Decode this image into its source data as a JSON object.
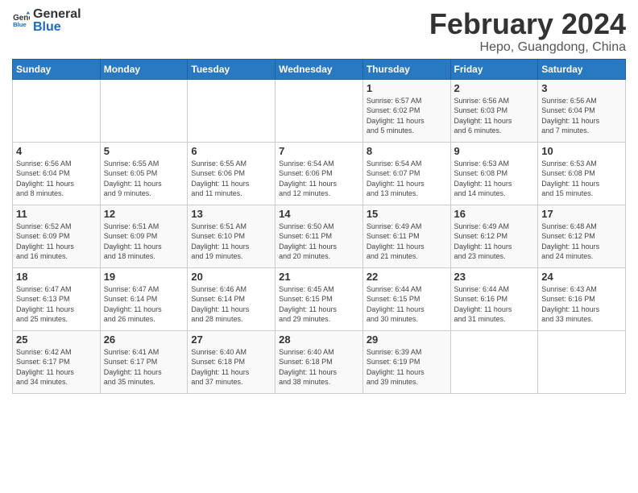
{
  "header": {
    "logo_general": "General",
    "logo_blue": "Blue",
    "title": "February 2024",
    "subtitle": "Hepo, Guangdong, China"
  },
  "weekdays": [
    "Sunday",
    "Monday",
    "Tuesday",
    "Wednesday",
    "Thursday",
    "Friday",
    "Saturday"
  ],
  "weeks": [
    [
      {
        "day": "",
        "info": ""
      },
      {
        "day": "",
        "info": ""
      },
      {
        "day": "",
        "info": ""
      },
      {
        "day": "",
        "info": ""
      },
      {
        "day": "1",
        "info": "Sunrise: 6:57 AM\nSunset: 6:02 PM\nDaylight: 11 hours\nand 5 minutes."
      },
      {
        "day": "2",
        "info": "Sunrise: 6:56 AM\nSunset: 6:03 PM\nDaylight: 11 hours\nand 6 minutes."
      },
      {
        "day": "3",
        "info": "Sunrise: 6:56 AM\nSunset: 6:04 PM\nDaylight: 11 hours\nand 7 minutes."
      }
    ],
    [
      {
        "day": "4",
        "info": "Sunrise: 6:56 AM\nSunset: 6:04 PM\nDaylight: 11 hours\nand 8 minutes."
      },
      {
        "day": "5",
        "info": "Sunrise: 6:55 AM\nSunset: 6:05 PM\nDaylight: 11 hours\nand 9 minutes."
      },
      {
        "day": "6",
        "info": "Sunrise: 6:55 AM\nSunset: 6:06 PM\nDaylight: 11 hours\nand 11 minutes."
      },
      {
        "day": "7",
        "info": "Sunrise: 6:54 AM\nSunset: 6:06 PM\nDaylight: 11 hours\nand 12 minutes."
      },
      {
        "day": "8",
        "info": "Sunrise: 6:54 AM\nSunset: 6:07 PM\nDaylight: 11 hours\nand 13 minutes."
      },
      {
        "day": "9",
        "info": "Sunrise: 6:53 AM\nSunset: 6:08 PM\nDaylight: 11 hours\nand 14 minutes."
      },
      {
        "day": "10",
        "info": "Sunrise: 6:53 AM\nSunset: 6:08 PM\nDaylight: 11 hours\nand 15 minutes."
      }
    ],
    [
      {
        "day": "11",
        "info": "Sunrise: 6:52 AM\nSunset: 6:09 PM\nDaylight: 11 hours\nand 16 minutes."
      },
      {
        "day": "12",
        "info": "Sunrise: 6:51 AM\nSunset: 6:09 PM\nDaylight: 11 hours\nand 18 minutes."
      },
      {
        "day": "13",
        "info": "Sunrise: 6:51 AM\nSunset: 6:10 PM\nDaylight: 11 hours\nand 19 minutes."
      },
      {
        "day": "14",
        "info": "Sunrise: 6:50 AM\nSunset: 6:11 PM\nDaylight: 11 hours\nand 20 minutes."
      },
      {
        "day": "15",
        "info": "Sunrise: 6:49 AM\nSunset: 6:11 PM\nDaylight: 11 hours\nand 21 minutes."
      },
      {
        "day": "16",
        "info": "Sunrise: 6:49 AM\nSunset: 6:12 PM\nDaylight: 11 hours\nand 23 minutes."
      },
      {
        "day": "17",
        "info": "Sunrise: 6:48 AM\nSunset: 6:12 PM\nDaylight: 11 hours\nand 24 minutes."
      }
    ],
    [
      {
        "day": "18",
        "info": "Sunrise: 6:47 AM\nSunset: 6:13 PM\nDaylight: 11 hours\nand 25 minutes."
      },
      {
        "day": "19",
        "info": "Sunrise: 6:47 AM\nSunset: 6:14 PM\nDaylight: 11 hours\nand 26 minutes."
      },
      {
        "day": "20",
        "info": "Sunrise: 6:46 AM\nSunset: 6:14 PM\nDaylight: 11 hours\nand 28 minutes."
      },
      {
        "day": "21",
        "info": "Sunrise: 6:45 AM\nSunset: 6:15 PM\nDaylight: 11 hours\nand 29 minutes."
      },
      {
        "day": "22",
        "info": "Sunrise: 6:44 AM\nSunset: 6:15 PM\nDaylight: 11 hours\nand 30 minutes."
      },
      {
        "day": "23",
        "info": "Sunrise: 6:44 AM\nSunset: 6:16 PM\nDaylight: 11 hours\nand 31 minutes."
      },
      {
        "day": "24",
        "info": "Sunrise: 6:43 AM\nSunset: 6:16 PM\nDaylight: 11 hours\nand 33 minutes."
      }
    ],
    [
      {
        "day": "25",
        "info": "Sunrise: 6:42 AM\nSunset: 6:17 PM\nDaylight: 11 hours\nand 34 minutes."
      },
      {
        "day": "26",
        "info": "Sunrise: 6:41 AM\nSunset: 6:17 PM\nDaylight: 11 hours\nand 35 minutes."
      },
      {
        "day": "27",
        "info": "Sunrise: 6:40 AM\nSunset: 6:18 PM\nDaylight: 11 hours\nand 37 minutes."
      },
      {
        "day": "28",
        "info": "Sunrise: 6:40 AM\nSunset: 6:18 PM\nDaylight: 11 hours\nand 38 minutes."
      },
      {
        "day": "29",
        "info": "Sunrise: 6:39 AM\nSunset: 6:19 PM\nDaylight: 11 hours\nand 39 minutes."
      },
      {
        "day": "",
        "info": ""
      },
      {
        "day": "",
        "info": ""
      }
    ]
  ]
}
